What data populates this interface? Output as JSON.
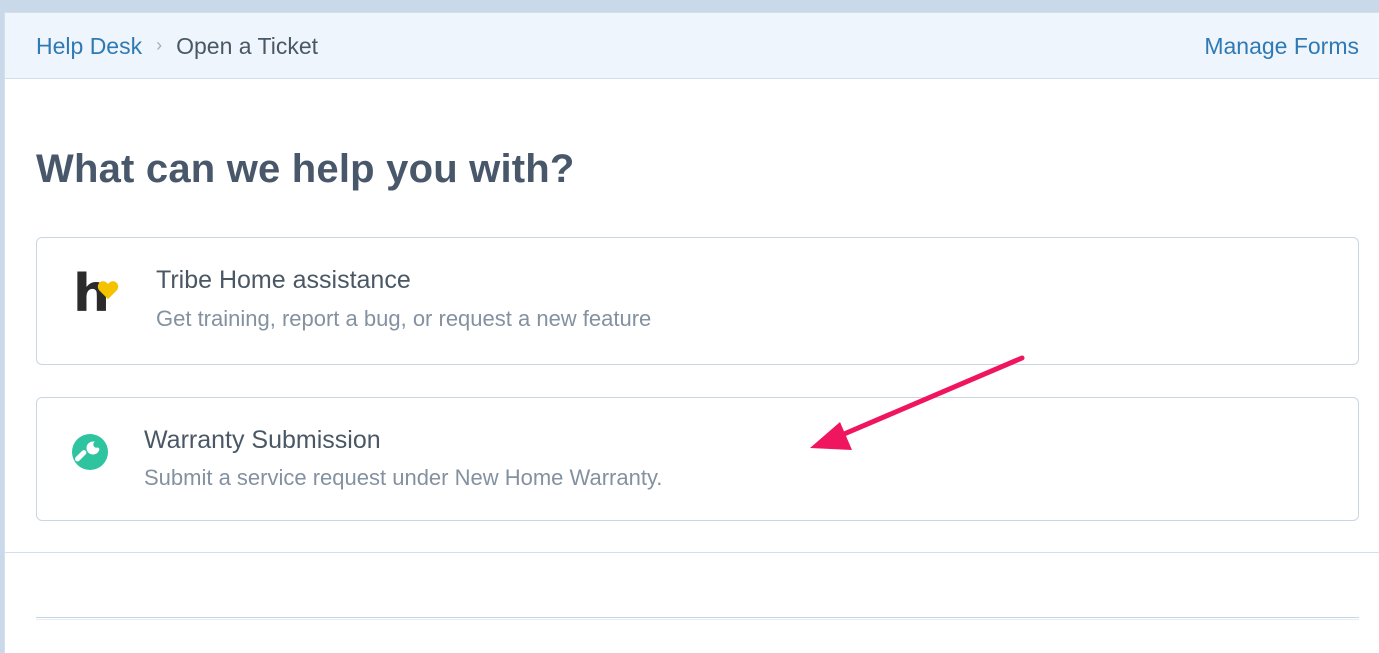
{
  "breadcrumb": {
    "root": "Help Desk",
    "separator": "›",
    "current": "Open a Ticket"
  },
  "header": {
    "manage_forms": "Manage Forms"
  },
  "main": {
    "heading": "What can we help you with?",
    "options": [
      {
        "icon": "tribe-home-logo-icon",
        "title": "Tribe Home assistance",
        "description": "Get training, report a bug, or request a new feature"
      },
      {
        "icon": "wrench-icon",
        "title": "Warranty Submission",
        "description": "Submit a service request under New Home Warranty."
      }
    ]
  },
  "logo_text": "h",
  "colors": {
    "link": "#2f7ab5",
    "heading": "#48586a",
    "logo_heart": "#f5c200",
    "wrench_bg": "#2ec4a0",
    "annotation_arrow": "#f0155f"
  }
}
